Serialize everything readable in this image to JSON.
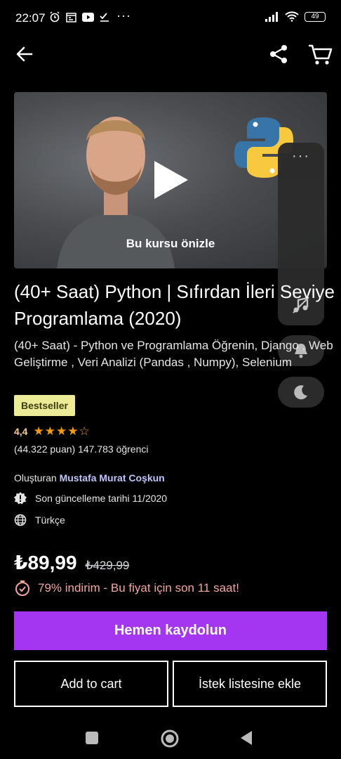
{
  "status_bar": {
    "time": "22:07",
    "battery": "49",
    "more": "···"
  },
  "video": {
    "preview_label": "Bu kursu önizle"
  },
  "floating_panel": {
    "dots": "···"
  },
  "course": {
    "title": "(40+ Saat) Python | Sıfırdan İleri Seviye Programlama (2020)",
    "subtitle": "(40+ Saat) - Python ve Programlama Öğrenin, Django , Web Geliştirme , Veri Analizi (Pandas , Numpy), Selenium",
    "badge": "Bestseller",
    "rating": 4.4,
    "rating_text": "4,4",
    "rating_counts": "(44.322 puan) 147.783 öğrenci",
    "created_by_label": "Oluşturan",
    "instructor": "Mustafa Murat Coşkun",
    "last_updated": "Son güncelleme tarihi 11/2020",
    "language": "Türkçe"
  },
  "pricing": {
    "price": "₺89,99",
    "old_price": "₺429,99",
    "discount_text": "79% indirim - Bu fiyat için son 11 saat!"
  },
  "buttons": {
    "enroll": "Hemen kaydolun",
    "add_to_cart": "Add to cart",
    "wishlist": "İstek listesine ekle"
  },
  "colors": {
    "accent": "#a435f0",
    "badge_bg": "#eceb98",
    "star": "#f69c08",
    "instructor_link": "#c0c4fc",
    "discount": "#f2a5a0"
  }
}
